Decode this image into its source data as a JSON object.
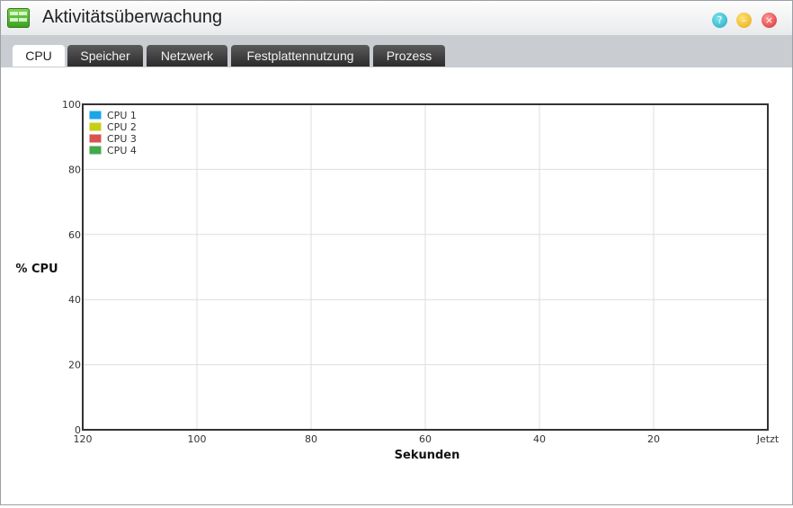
{
  "window": {
    "title": "Aktivitätsüberwachung"
  },
  "window_controls": {
    "help_glyph": "?",
    "minimize_glyph": "–",
    "close_glyph": "×"
  },
  "tabs": [
    {
      "label": "CPU",
      "active": true
    },
    {
      "label": "Speicher",
      "active": false
    },
    {
      "label": "Netzwerk",
      "active": false
    },
    {
      "label": "Festplattennutzung",
      "active": false
    },
    {
      "label": "Prozess",
      "active": false
    }
  ],
  "chart_data": {
    "type": "line",
    "ylabel": "% CPU",
    "xlabel": "Sekunden",
    "ylim": [
      0,
      100
    ],
    "y_ticks": [
      "0",
      "20",
      "40",
      "60",
      "80",
      "100"
    ],
    "x_ticks": [
      "120",
      "100",
      "80",
      "60",
      "40",
      "20",
      "Jetzt"
    ],
    "grid": true,
    "legend_position": "top-left",
    "series": [
      {
        "name": "CPU 1",
        "color": "#1aa5e6",
        "values": []
      },
      {
        "name": "CPU 2",
        "color": "#c6cf13",
        "values": []
      },
      {
        "name": "CPU 3",
        "color": "#d9534f",
        "values": []
      },
      {
        "name": "CPU 4",
        "color": "#45a84c",
        "values": []
      }
    ]
  }
}
